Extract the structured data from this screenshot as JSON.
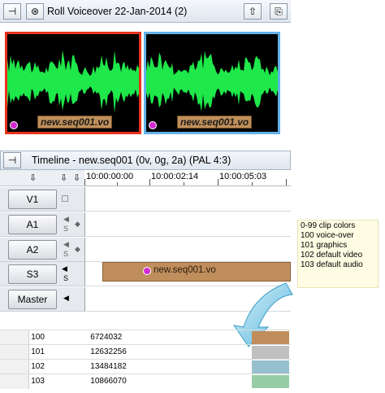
{
  "roll": {
    "title": "Roll  Voiceover 22-Jan-2014 (2)",
    "clips": [
      {
        "name": "new.seq001.vo",
        "border_color": "#e8321c"
      },
      {
        "name": "new.seq001.vo",
        "border_color": "#63b2ea"
      }
    ],
    "waveform_color": "#1ee84a"
  },
  "timeline": {
    "title": "Timeline - new.seq001 (0v, 0g, 2a) (PAL 4:3)",
    "timecodes": [
      "10:00:00:00",
      "10:00:02:14",
      "10:00:05:03"
    ],
    "tracks": [
      {
        "label": "V1"
      },
      {
        "label": "A1",
        "solo": "S"
      },
      {
        "label": "A2",
        "solo": "S"
      },
      {
        "label": "S3",
        "solo": "S"
      },
      {
        "label": "Master"
      }
    ],
    "clip_name": "new.seq001.vo"
  },
  "note": {
    "lines": [
      "0-99 clip colors",
      "100 voice-over",
      "101 graphics",
      "102 default video",
      "103 default audio"
    ]
  },
  "color_table": [
    {
      "index": "100",
      "value": "6724032",
      "color": "#bf8e5c"
    },
    {
      "index": "101",
      "value": "12632256",
      "color": "#c0c0c0"
    },
    {
      "index": "102",
      "value": "13484182",
      "color": "#96c0cd"
    },
    {
      "index": "103",
      "value": "10866070",
      "color": "#96cda5"
    }
  ]
}
